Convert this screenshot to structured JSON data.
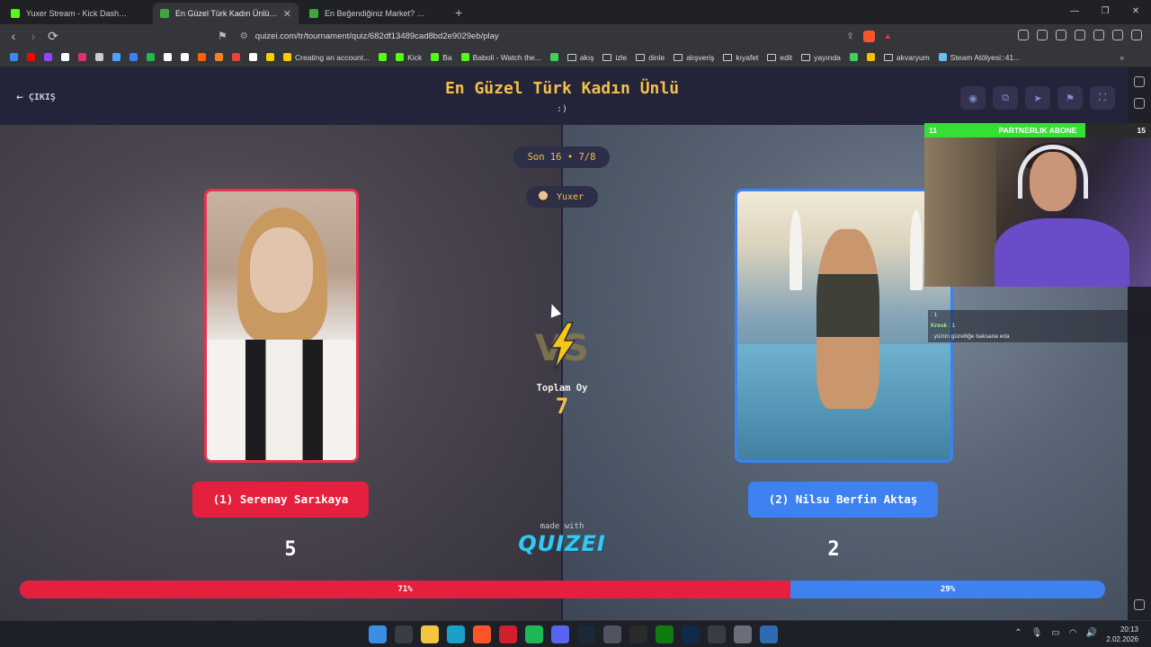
{
  "browser": {
    "tabs": [
      {
        "title": "Yuxer Stream - Kick Dashboard",
        "favicon_color": "#53fc18",
        "active": false
      },
      {
        "title": "En Güzel Türk Kadın Ünlü - Tier l",
        "favicon_color": "#3ea63e",
        "active": true
      },
      {
        "title": "En Beğendiğiniz Market? - Tier List |",
        "favicon_color": "#3ea63e",
        "active": false
      }
    ],
    "new_tab_label": "+",
    "url": "quizei.com/tr/tournament/quiz/682df13489cad8bd2e9029eb/play",
    "bookmarks": [
      {
        "label": "",
        "icon": "google-icon",
        "color": "#4285f4"
      },
      {
        "label": "",
        "icon": "youtube-icon",
        "color": "#ff0000"
      },
      {
        "label": "",
        "icon": "twitch-icon",
        "color": "#9146ff"
      },
      {
        "label": "",
        "icon": "x-icon",
        "color": "#ffffff"
      },
      {
        "label": "",
        "icon": "instagram-icon",
        "color": "#e1306c"
      },
      {
        "label": "",
        "icon": "github-icon",
        "color": "#cccccc"
      },
      {
        "label": "",
        "icon": "cloud-icon",
        "color": "#4aa3ff"
      },
      {
        "label": "",
        "icon": "chart-icon",
        "color": "#3b82f6"
      },
      {
        "label": "",
        "icon": "music-icon",
        "color": "#1db954"
      },
      {
        "label": "",
        "icon": "w-icon",
        "color": "#ffffff"
      },
      {
        "label": "",
        "icon": "tiktok-icon",
        "color": "#ffffff"
      },
      {
        "label": "",
        "icon": "hb-icon",
        "color": "#ff6000"
      },
      {
        "label": "",
        "icon": "gear-icon",
        "color": "#f58220"
      },
      {
        "label": "",
        "icon": "mail-icon",
        "color": "#ea4335"
      },
      {
        "label": "",
        "icon": "amazon-icon",
        "color": "#ffffff"
      },
      {
        "label": "",
        "icon": "note-icon",
        "color": "#f5d000"
      },
      {
        "label": "Creating an account...",
        "icon": "doc-icon",
        "color": "#ffcc00"
      },
      {
        "label": "",
        "icon": "kick-icon",
        "color": "#53fc18"
      },
      {
        "label": "Kick",
        "icon": "kick-icon",
        "color": "#53fc18"
      },
      {
        "label": "Ba",
        "icon": "kick-icon",
        "color": "#53fc18"
      },
      {
        "label": "Baboli - Watch the...",
        "icon": "kick-icon",
        "color": "#53fc18"
      },
      {
        "label": "",
        "icon": "dot-icon",
        "color": "#3fd15a"
      },
      {
        "label": "akış",
        "icon": "folder-icon",
        "color": ""
      },
      {
        "label": "izle",
        "icon": "folder-icon",
        "color": ""
      },
      {
        "label": "dinle",
        "icon": "folder-icon",
        "color": ""
      },
      {
        "label": "alışveriş",
        "icon": "folder-icon",
        "color": ""
      },
      {
        "label": "kıyafet",
        "icon": "folder-icon",
        "color": ""
      },
      {
        "label": "edit",
        "icon": "folder-icon",
        "color": ""
      },
      {
        "label": "yayında",
        "icon": "folder-icon",
        "color": ""
      },
      {
        "label": "",
        "icon": "green-icon",
        "color": "#3fd15a"
      },
      {
        "label": "",
        "icon": "yellow-icon",
        "color": "#f5c000"
      },
      {
        "label": "akvaryum",
        "icon": "folder-icon",
        "color": ""
      },
      {
        "label": "Steam Atölyesi::41...",
        "icon": "steam-icon",
        "color": "#66c0f4"
      }
    ],
    "bookmarks_more": "»"
  },
  "quiz": {
    "exit_label": "ÇIKIŞ",
    "title": "En Güzel Türk Kadın Ünlü",
    "subtitle": ":)",
    "round": "Son 16 • 7/8",
    "user": "Yuxer",
    "total_votes_label": "Toplam Oy",
    "total_votes": "7",
    "made_with": "made with",
    "brand": "QUIZEI",
    "left": {
      "label": "(1) Serenay Sarıkaya",
      "votes": "5",
      "percent_label": "71%",
      "percent": 71,
      "color": "#e5203e"
    },
    "right": {
      "label": "(2) Nilsu Berfin Aktaş",
      "votes": "2",
      "percent_label": "29%",
      "percent": 29,
      "color": "#3d82f0"
    }
  },
  "stream_overlay": {
    "left_count": "11",
    "title": "PARTNERLIK ABONE",
    "right_count": "15",
    "progress": 0.71,
    "chat": [
      {
        "name": "",
        "text": ": 1"
      },
      {
        "name": "Kresk",
        "text": ": 1"
      },
      {
        "name": "",
        "text": ": yüzün güzelliğe baksana eda"
      }
    ]
  },
  "taskbar": {
    "time": "20:13",
    "date": "2.02.2026"
  }
}
